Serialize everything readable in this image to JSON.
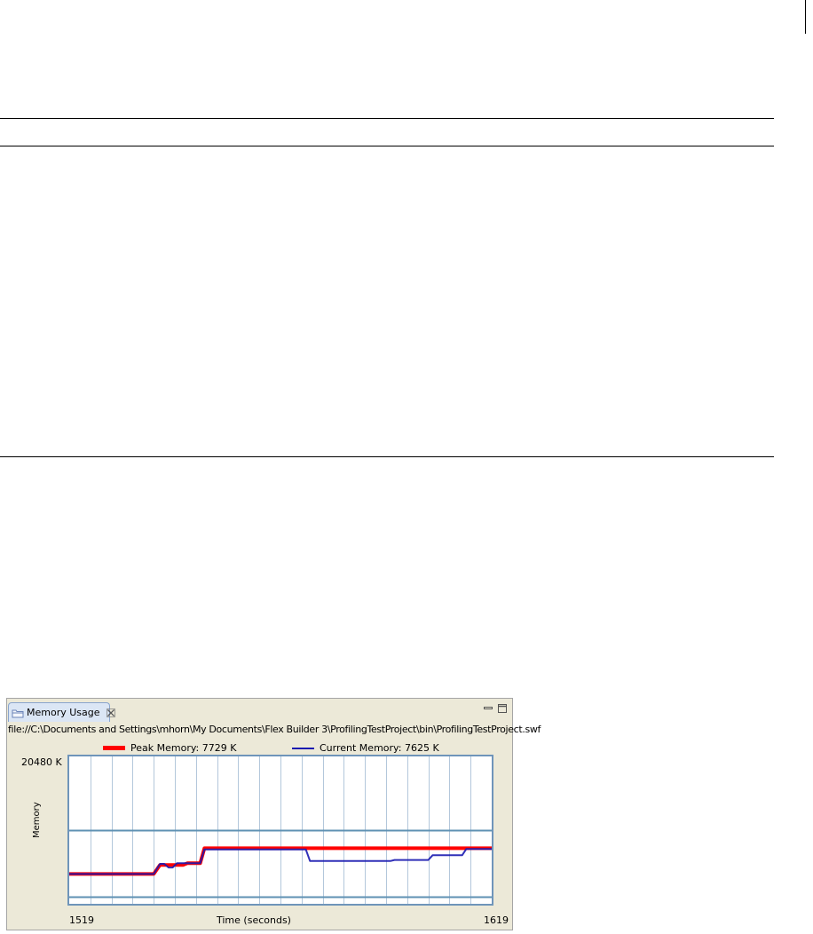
{
  "view": {
    "tab_label": "Memory Usage",
    "tab_icon": "folder-icon",
    "close_icon": "close-icon",
    "minimize_icon": "minimize-icon",
    "maximize_icon": "maximize-icon",
    "file_path": "file://C:\\Documents and Settings\\mhorn\\My Documents\\Flex Builder 3\\ProfilingTestProject\\bin\\ProfilingTestProject.swf"
  },
  "legend": {
    "peak_label": "Peak Memory: 7729 K",
    "current_label": "Current Memory: 7625 K"
  },
  "colors": {
    "peak": "#ff0000",
    "current": "#1a1ab0",
    "plot_border": "#6f95ba",
    "gridline": "#b3c7db",
    "hline": "#5f91b3",
    "tab_bg": "#dbe6f5",
    "panel_bg": "#ece9d8"
  },
  "chart_data": {
    "type": "line",
    "title": "",
    "xlabel": "Time (seconds)",
    "ylabel": "Memory",
    "x_min_label": "1519",
    "x_max_label": "1619",
    "y_max_label": "20480 K",
    "xlim": [
      1519,
      1619
    ],
    "ylim": [
      0,
      20480
    ],
    "grid": true,
    "legend_position": "top",
    "horizontal_lines": [
      10240,
      1024
    ],
    "series": [
      {
        "name": "Peak Memory",
        "color": "#ff0000",
        "points": [
          [
            1519,
            4150
          ],
          [
            1539,
            4150
          ],
          [
            1540.5,
            5400
          ],
          [
            1546,
            5400
          ],
          [
            1547,
            5650
          ],
          [
            1550,
            5650
          ],
          [
            1551,
            7729
          ],
          [
            1619,
            7729
          ]
        ]
      },
      {
        "name": "Current Memory",
        "color": "#1a1ab0",
        "points": [
          [
            1519,
            4150
          ],
          [
            1539,
            4150
          ],
          [
            1540.5,
            5550
          ],
          [
            1541.5,
            5550
          ],
          [
            1542.5,
            5050
          ],
          [
            1543.5,
            5050
          ],
          [
            1544.5,
            5650
          ],
          [
            1550,
            5650
          ],
          [
            1551,
            7550
          ],
          [
            1575,
            7550
          ],
          [
            1576,
            5950
          ],
          [
            1595,
            5950
          ],
          [
            1596,
            6100
          ],
          [
            1604,
            6100
          ],
          [
            1605,
            6750
          ],
          [
            1612,
            6750
          ],
          [
            1613,
            7625
          ],
          [
            1619,
            7625
          ]
        ]
      }
    ]
  }
}
